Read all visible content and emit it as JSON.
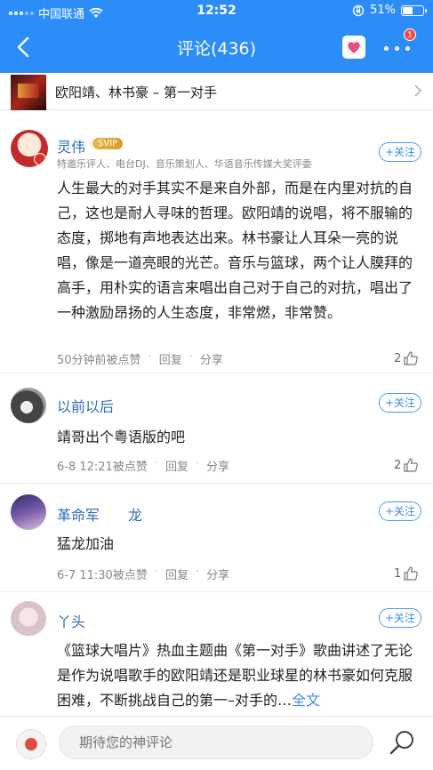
{
  "status": {
    "carrier": "中国联通",
    "time": "12:52",
    "battery_text": "51%",
    "battery_level": 0.51
  },
  "nav": {
    "title": "评论(436)",
    "badge_count": "1"
  },
  "song": {
    "title": "欧阳靖、林书豪 – 第一对手"
  },
  "follow_label": "+关注",
  "reply_label": "回复",
  "share_label": "分享",
  "dot_sep": "·",
  "comments": [
    {
      "user": "灵伟",
      "vip": "SVIP",
      "title": "特邀乐评人、电台DJ、音乐策划人、华语音乐传媒大奖评委",
      "text": "人生最大的对手其实不是来自外部，而是在内里对抗的自己，这也是耐人寻味的哲理。欧阳靖的说唱，将不服输的态度，掷地有声地表达出来。林书豪让人耳朵一亮的说唱，像是一道亮眼的光芒。音乐与篮球，两个让人膜拜的高手，用朴实的语言来唱出自己对于自己的对抗，唱出了一种激励昂扬的人生态度，非常燃，非常赞。",
      "time": "50分钟前被点赞",
      "likes": "2"
    },
    {
      "user": "以前以后",
      "text": "靖哥出个粤语版的吧",
      "time": "6-8 12:21被点赞",
      "likes": "2"
    },
    {
      "user": "革命军　　龙",
      "text": "猛龙加油",
      "time": "6-7 11:30被点赞",
      "likes": "1"
    },
    {
      "user": "丫头",
      "text": "《篮球大唱片》热血主题曲《第一对手》歌曲讲述了无论是作为说唱歌手的欧阳靖还是职业球星的林书豪如何克服困难，不断挑战自己的第一–对手的…",
      "more": "全文"
    }
  ],
  "composer": {
    "placeholder": "期待您的神评论"
  },
  "colors": {
    "header_bg": "#2c8df8",
    "link_blue": "#2c6fb8",
    "vip_gold": "#e0a93a",
    "badge_red": "#f54a45"
  },
  "icons": [
    "back-arrow-icon",
    "heart-icon",
    "more-icon",
    "chevron-right-icon",
    "thumb-up-icon",
    "search-icon",
    "wifi-icon",
    "lock-rotation-icon"
  ]
}
